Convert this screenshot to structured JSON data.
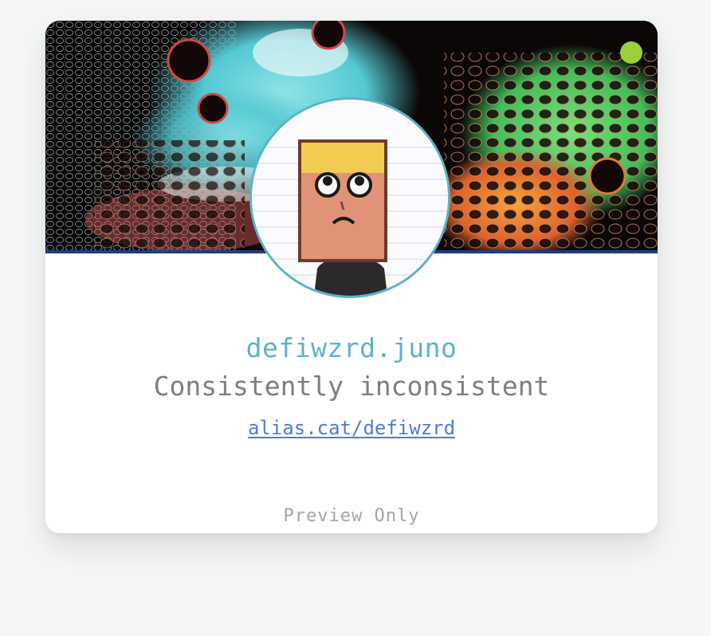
{
  "profile": {
    "handle": "defiwzrd.juno",
    "bio": "Consistently inconsistent",
    "link_text": "alias.cat/defiwzrd",
    "footer_note": "Preview Only"
  },
  "colors": {
    "page_background": "#f5f6f6",
    "card_background": "#ffffff",
    "handle_color": "#5eb2c8",
    "bio_color": "#7f7e7a",
    "link_color": "#4f7bd6",
    "preview_color": "#a5a3a6",
    "banner_rule": "#1f3f7a",
    "avatar_border": "#5eb2c8"
  },
  "images": {
    "banner": "abstract-fluid-art-banner",
    "avatar": "sad-box-head-character-avatar"
  }
}
